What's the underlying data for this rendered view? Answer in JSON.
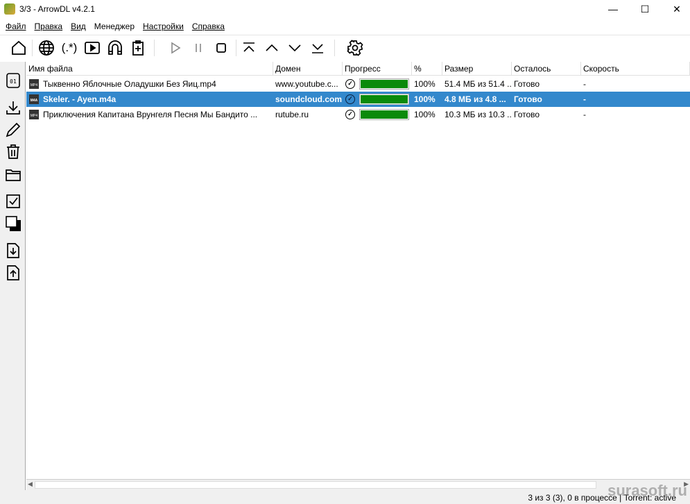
{
  "window": {
    "title": "3/3 - ArrowDL v4.2.1",
    "minimize": "—",
    "maximize": "☐",
    "close": "✕"
  },
  "menu": [
    "Файл",
    "Правка",
    "Вид",
    "Менеджер",
    "Настройки",
    "Справка"
  ],
  "toolbar": {
    "regex_label": "(.*)"
  },
  "table": {
    "columns": [
      "Имя файла",
      "Домен",
      "Прогресс",
      "%",
      "Размер",
      "Осталось",
      "Скорость"
    ],
    "rows": [
      {
        "name": "Тыквенно Яблочные Оладушки Без Яиц.mp4",
        "domain": "www.youtube.c...",
        "progress": 100,
        "percent": "100%",
        "size": "51.4 МБ из 51.4 ...",
        "remaining": "Готово",
        "speed": "-",
        "icon": "MP4"
      },
      {
        "name": "Skeler. - Ayen.m4a",
        "domain": "soundcloud.com",
        "progress": 100,
        "percent": "100%",
        "size": "4.8 МБ из 4.8 ...",
        "remaining": "Готово",
        "speed": "-",
        "icon": "M4A",
        "selected": true
      },
      {
        "name": "Приключения Капитана Врунгеля Песня Мы Бандито ...",
        "domain": "rutube.ru",
        "progress": 100,
        "percent": "100%",
        "size": "10.3 МБ из 10.3 ...",
        "remaining": "Готово",
        "speed": "-",
        "icon": "MP4"
      }
    ]
  },
  "status": {
    "text": "3 из 3 (3), 0 в процессе | Torrent: active"
  },
  "watermark": "surasoft.ru",
  "colors": {
    "selection": "#3388cc",
    "progress": "#0a8a0a"
  }
}
